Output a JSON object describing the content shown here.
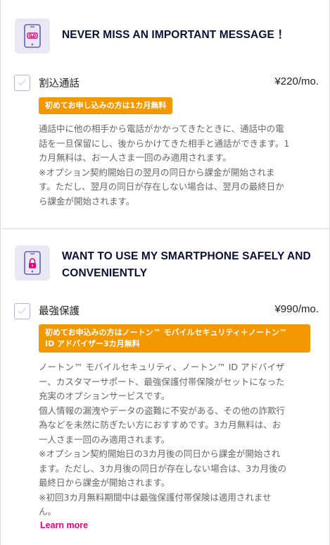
{
  "sections": [
    {
      "icon": "phone-voicemail-icon",
      "title": "NEVER MISS AN IMPORTANT MESSAGE ！",
      "option_label": "割込通話",
      "price": "¥220/mo.",
      "badge": "初めてお申し込みの方は1カ月無料",
      "description_lines": [
        "通話中に他の相手から電話がかかってきたときに、通話中の電",
        "話を一旦保留にし、後からかけてきた相手と通話ができます。1",
        "カ月無料は、お一人さま一回のみ適用されます。",
        "※オプション契約開始日の翌月の同日から課金が開始されま",
        "す。ただし、翌月の同日が存在しない場合は、翌月の最終日か",
        "ら課金が開始されます。"
      ]
    },
    {
      "icon": "phone-lock-icon",
      "title_lines": [
        "WANT TO USE MY SMARTPHONE SAFELY AND",
        "CONVENIENTLY"
      ],
      "option_label": "最強保護",
      "price": "¥990/mo.",
      "badge_lines": [
        "初めてお申込みの方はノートン™ モバイルセキュリティ＋ノートン™",
        "ID アドバイザー3カ月無料"
      ],
      "description_lines": [
        "ノートン™ モバイルセキュリティ、ノートン™ ID アドバイザ",
        "ー、カスタマーサポート、最強保護付帯保険がセットになった",
        "充実のオプションサービスです。",
        "個人情報の漏洩やデータの盗難に不安がある、その他の詐欺行",
        "為などを未然に防ぎたい方におすすめです。3カ月無料は、お",
        "一人さま一回のみ適用されます。",
        "※オプション契約開始日の3カ月後の同日から課金が開始され",
        "ます。ただし、3カ月後の同日が存在しない場合は、3カ月後の",
        "最終日から課金が開始されます。",
        "※初回3カ月無料期間中は最強保護付帯保険は適用されませ",
        "ん。"
      ],
      "learn_more": "Learn more"
    }
  ],
  "colors": {
    "title": "#0a1038",
    "badge": "#f39800",
    "link": "#e6007e",
    "icon_bg": "#e9e8f5",
    "icon_accent": "#e6007e",
    "icon_frame": "#6b5fb5"
  }
}
